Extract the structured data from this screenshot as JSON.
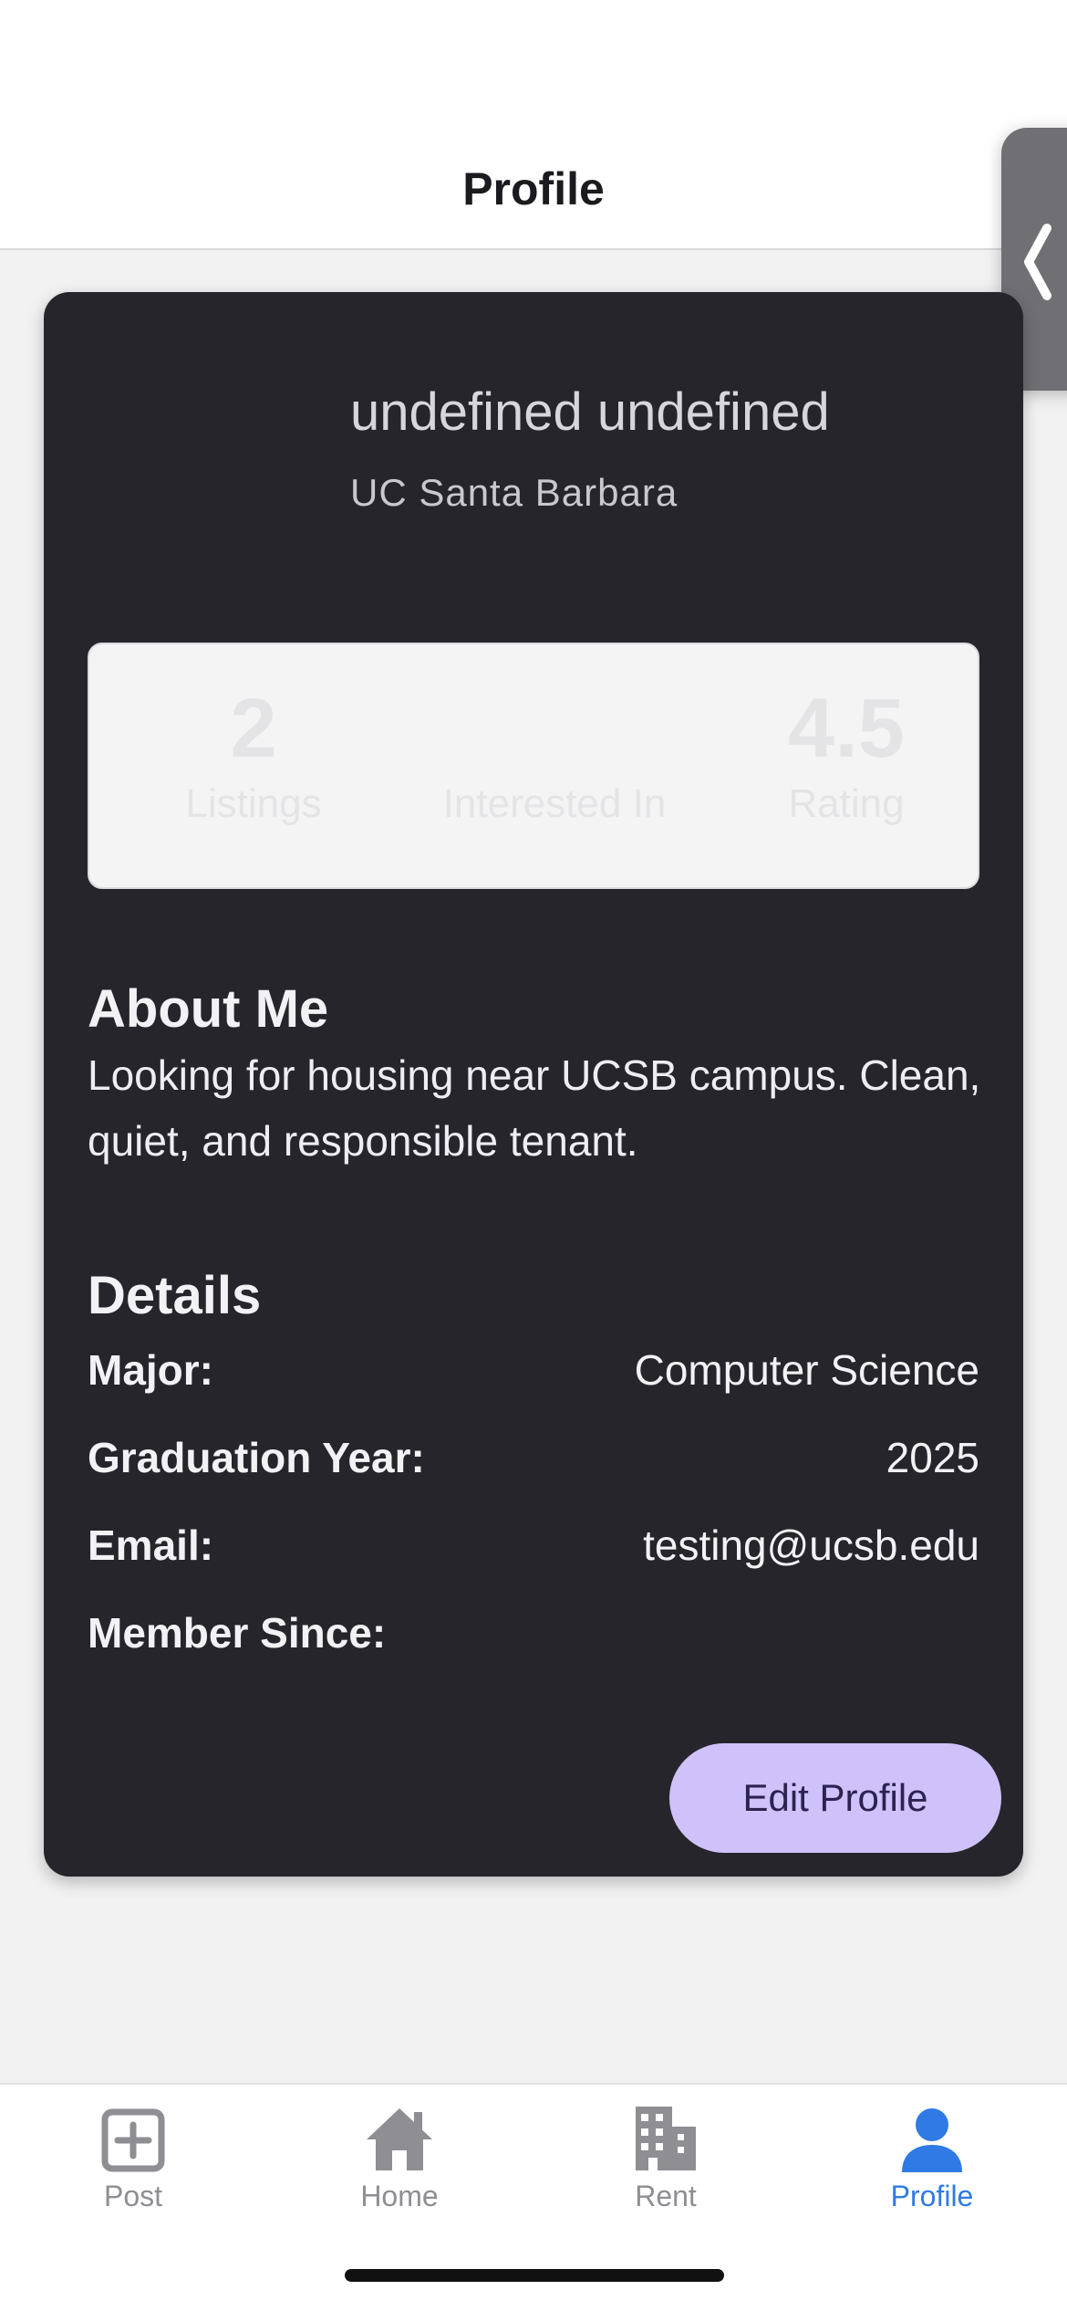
{
  "header": {
    "title": "Profile"
  },
  "profile": {
    "name": "undefined undefined",
    "school": "UC Santa Barbara"
  },
  "stats": {
    "listings": {
      "value": "2",
      "label": "Listings"
    },
    "interested": {
      "value": "",
      "label": "Interested In"
    },
    "rating": {
      "value": "4.5",
      "label": "Rating"
    }
  },
  "about": {
    "title": "About Me",
    "text": "Looking for housing near UCSB campus. Clean, quiet, and responsible tenant."
  },
  "details": {
    "title": "Details",
    "major": {
      "label": "Major:",
      "value": "Computer Science"
    },
    "graduation": {
      "label": "Graduation Year:",
      "value": "2025"
    },
    "email": {
      "label": "Email:",
      "value": "testing@ucsb.edu"
    },
    "member_since": {
      "label": "Member Since:",
      "value": ""
    }
  },
  "edit_button": {
    "label": "Edit Profile"
  },
  "tabbar": {
    "items": [
      {
        "label": "Post",
        "icon": "plus-square-icon"
      },
      {
        "label": "Home",
        "icon": "house-icon"
      },
      {
        "label": "Rent",
        "icon": "building-icon"
      },
      {
        "label": "Profile",
        "icon": "person-icon",
        "active": true
      }
    ]
  },
  "colors": {
    "card_bg": "#27252c",
    "accent_button": "#cfc2fb",
    "active_tab": "#2f7ae5",
    "inactive_tab": "#8e8e93"
  }
}
